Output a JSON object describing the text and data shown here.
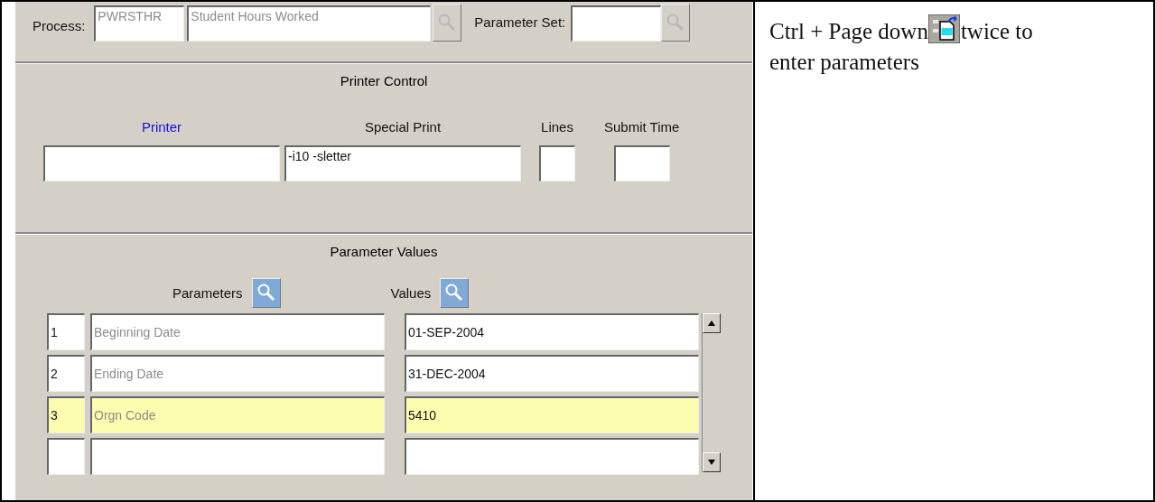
{
  "process": {
    "label": "Process:",
    "code": "PWRSTHR",
    "name": "Student Hours Worked",
    "lookup_disabled": true
  },
  "parameter_set": {
    "label": "Parameter Set:",
    "lookup_disabled": true
  },
  "printer_control": {
    "title": "Printer Control",
    "fields": [
      {
        "label": "Printer",
        "current": true
      },
      {
        "label": "Special Print",
        "value": "-i10 -sletter",
        "current": false
      },
      {
        "label": "Lines",
        "current": false
      },
      {
        "label": "Submit Time",
        "current": false
      }
    ]
  },
  "parameter_values": {
    "title": "Parameter Values",
    "parameters_header": "Parameters",
    "values_header": "Values",
    "lookup_disabled": false,
    "rows": [
      {
        "number": "1",
        "parameter": "Beginning Date",
        "value": "01-SEP-2004",
        "selected": false
      },
      {
        "number": "2",
        "parameter": "Ending Date",
        "value": "31-DEC-2004",
        "selected": false
      },
      {
        "number": "3",
        "parameter": "Orgn Code",
        "value": "5410",
        "selected": true
      },
      {
        "number": "",
        "parameter": "",
        "value": "",
        "selected": false
      }
    ]
  },
  "instruction": {
    "before": "Ctrl + Page down",
    "after": "twice to",
    "continuation": "enter parameters"
  }
}
